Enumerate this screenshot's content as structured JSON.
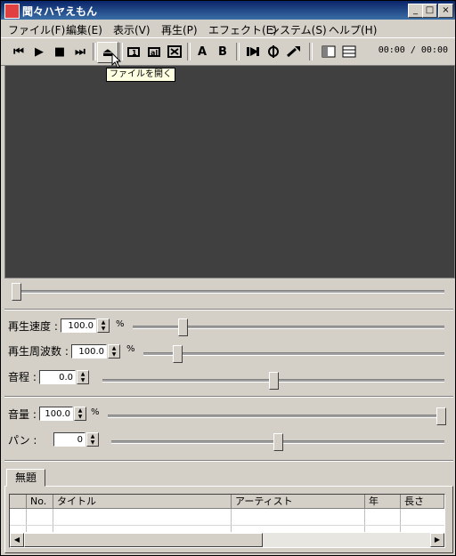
{
  "window": {
    "title": "聞々ハヤえもん",
    "minimize": "_",
    "maximize": "□",
    "close": "×"
  },
  "menu": [
    "ファイル(F)",
    "編集(E)",
    "表示(V)",
    "再生(P)",
    "エフェクト(E)",
    "システム(S)",
    "ヘルプ(H)"
  ],
  "toolbar": {
    "labels": {
      "prev": "⏮",
      "play": "▶",
      "stop": "■",
      "next": "⏭",
      "open": "⏏",
      "a": "A",
      "b": "B"
    },
    "time": "00:00 / 00:00",
    "tooltip": "ファイルを開く"
  },
  "controls": {
    "seek_position": 0.0,
    "speed": {
      "label": "再生速度 :",
      "value": "100.0",
      "unit": "%",
      "level": 0.15
    },
    "frequency": {
      "label": "再生周波数 :",
      "value": "100.0",
      "unit": "%",
      "level": 0.1
    },
    "pitch": {
      "label": "音程 :",
      "value": "0.0",
      "level": 0.5
    },
    "volume": {
      "label": "音量 :",
      "value": "100.0",
      "unit": "%",
      "level": 1.0
    },
    "pan": {
      "label": "パン :",
      "value": "0",
      "level": 0.5
    }
  },
  "playlist": {
    "tab": "無題",
    "columns": [
      "",
      "No.",
      "タイトル",
      "アーティスト",
      "年",
      "長さ"
    ]
  },
  "colors": {
    "titlebar": "#0a246a",
    "video": "#404040",
    "face": "#d4d0c8"
  }
}
